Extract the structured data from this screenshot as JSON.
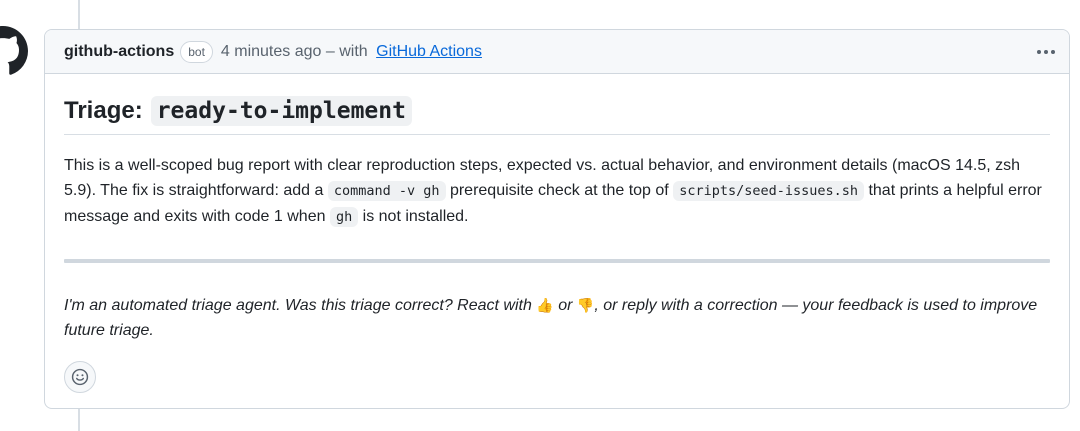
{
  "comment": {
    "author": "github-actions",
    "badge": "bot",
    "timestamp": "4 minutes ago",
    "via_prefix": "– with",
    "app_link": "GitHub Actions",
    "avatar_icon": "github-mark-icon",
    "menu_icon": "kebab-horizontal-icon"
  },
  "body": {
    "title_prefix": "Triage:",
    "title_code": "ready-to-implement",
    "paragraph": {
      "part1": "This is a well-scoped bug report with clear reproduction steps, expected vs. actual behavior, and environment details (macOS 14.5, zsh 5.9). The fix is straightforward: add a ",
      "code1": "command -v gh",
      "part2": " prerequisite check at the top of ",
      "code2": "scripts/seed-issues.sh",
      "part3": " that prints a helpful error message and exits with code 1 when ",
      "code3": "gh",
      "part4": " is not installed."
    },
    "note": {
      "part1": "I'm an automated triage agent. Was this triage correct? React with ",
      "thumbs_up": "👍",
      "part2": " or ",
      "thumbs_down": "👎",
      "part3": ", or reply with a correction — your feedback is used to improve future triage."
    }
  },
  "reactions": {
    "add_reaction_icon": "smiley-icon"
  },
  "colors": {
    "link": "#0969da",
    "border": "#d0d7de",
    "header_bg": "#f6f8fa",
    "muted_text": "#59636e",
    "code_bg": "#eff1f3"
  }
}
